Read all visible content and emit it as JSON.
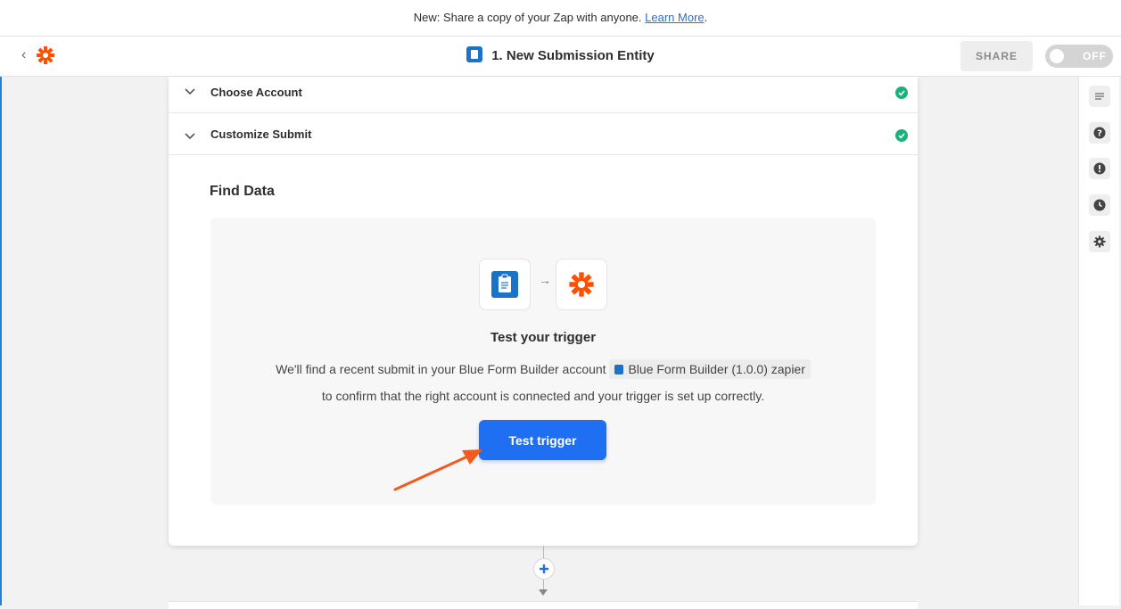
{
  "banner": {
    "text": "New: Share a copy of your Zap with anyone.",
    "link": "Learn More",
    "suffix": "."
  },
  "header": {
    "back_icon": "chevron-left-icon",
    "logo_icon": "zapier-asterisk-icon",
    "title": "1. New Submission Entity",
    "share_label": "SHARE",
    "toggle_label": "OFF"
  },
  "sections": [
    {
      "label": "Choose Account",
      "status": "complete"
    },
    {
      "label": "Customize Submit",
      "status": "complete"
    }
  ],
  "find_data": {
    "title": "Find Data",
    "test_title": "Test your trigger",
    "desc_before": "We'll find a recent submit in your Blue Form Builder account",
    "chip": "Blue Form Builder (1.0.0) zapier",
    "desc_after": "to confirm that the right account is connected and your trigger is set up correctly.",
    "button_label": "Test trigger"
  },
  "right_sidebar": [
    "outline-icon",
    "help-icon",
    "alert-icon",
    "history-icon",
    "settings-icon"
  ],
  "colors": {
    "accent": "#1f6ff2",
    "zapier_orange": "#ff4f00",
    "success": "#19b37a",
    "annotation_arrow": "#f25a1e"
  }
}
